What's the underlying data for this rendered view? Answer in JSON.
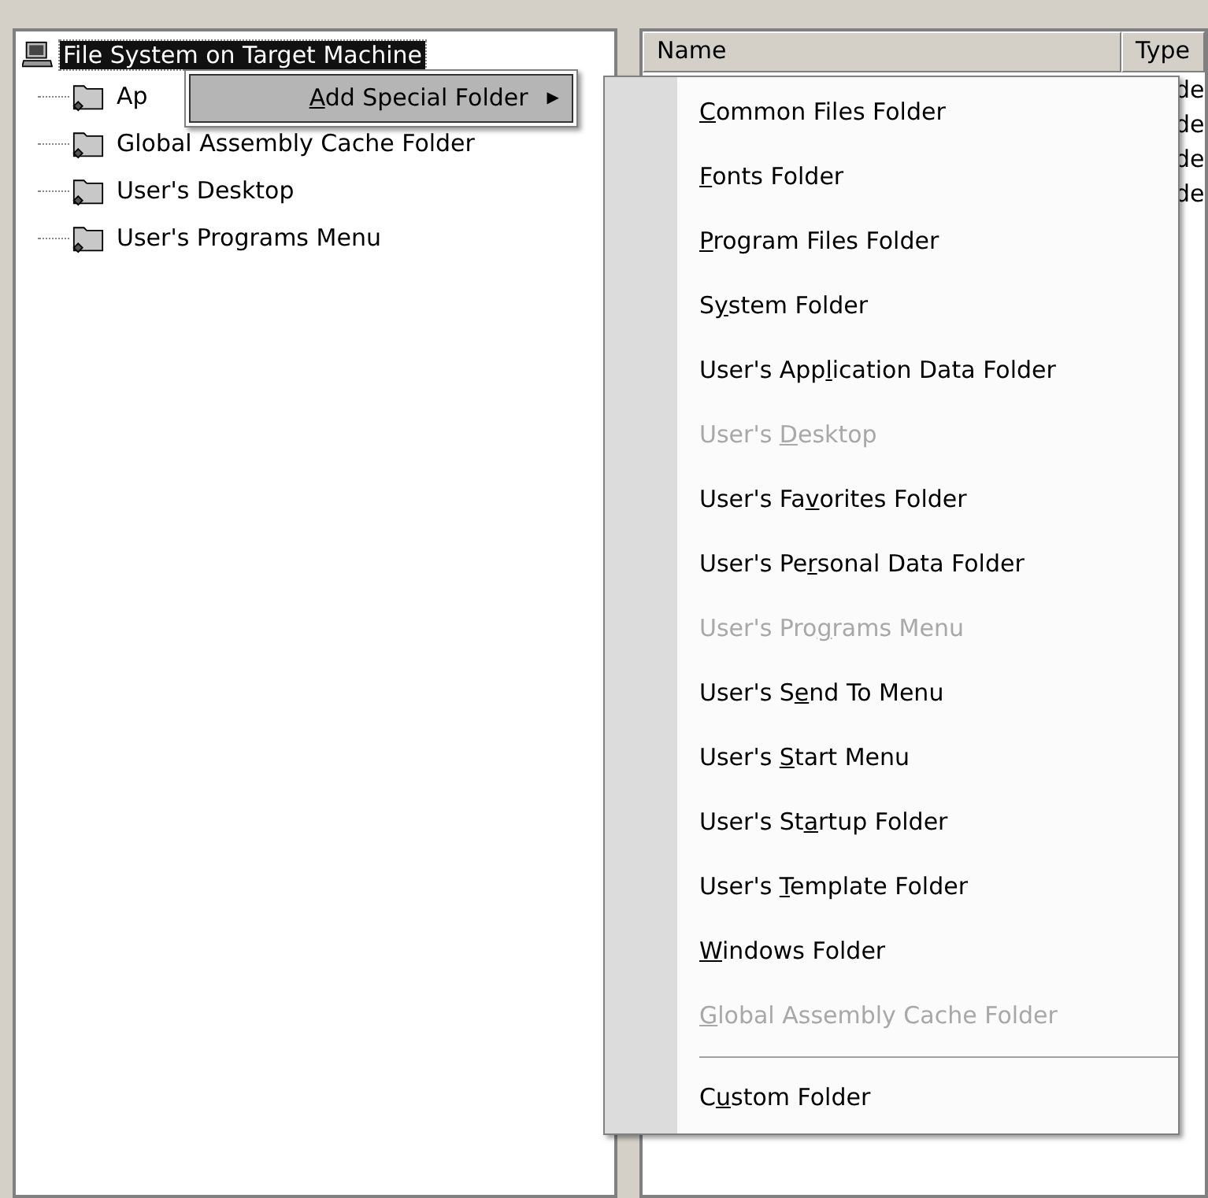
{
  "tree": {
    "label": "File System on Target Machine",
    "selected": true,
    "children": [
      {
        "label": "Ap"
      },
      {
        "label": "Global Assembly Cache Folder"
      },
      {
        "label": "User's Desktop"
      },
      {
        "label": "User's Programs Menu"
      }
    ]
  },
  "list": {
    "columns": [
      "Name",
      "Type"
    ],
    "rows": [
      {
        "column_2": "de"
      },
      {
        "column_2": "de"
      },
      {
        "column_2": "de"
      },
      {
        "column_2": "de"
      }
    ]
  },
  "context_menu": {
    "items": [
      {
        "label": {
          "key": "A",
          "after": "dd Special Folder"
        },
        "submenu_arrow": "▶",
        "selected": true
      }
    ]
  },
  "submenu": {
    "items": [
      {
        "kind": "item",
        "label": {
          "key": "C",
          "after": "ommon Files Folder"
        },
        "disabled": false
      },
      {
        "kind": "item",
        "label": {
          "key": "F",
          "after": "onts Folder"
        },
        "disabled": false
      },
      {
        "kind": "item",
        "label": {
          "key": "P",
          "after": "rogram Files Folder"
        },
        "disabled": false
      },
      {
        "kind": "item",
        "label": {
          "before": "S",
          "key": "y",
          "after": "stem Folder"
        },
        "disabled": false
      },
      {
        "kind": "item",
        "label": {
          "before": "User's App",
          "key": "l",
          "after": "ication Data Folder"
        },
        "disabled": false
      },
      {
        "kind": "item",
        "label": {
          "before": "User's ",
          "key": "D",
          "after": "esktop"
        },
        "disabled": true
      },
      {
        "kind": "item",
        "label": {
          "before": "User's Fa",
          "key": "v",
          "after": "orites Folder"
        },
        "disabled": false
      },
      {
        "kind": "item",
        "label": {
          "before": "User's Pe",
          "key": "r",
          "after": "sonal Data Folder"
        },
        "disabled": false
      },
      {
        "kind": "item",
        "label": {
          "before": "User's Pro",
          "key": "g",
          "after": "rams Menu"
        },
        "disabled": true
      },
      {
        "kind": "item",
        "label": {
          "before": "User's S",
          "key": "e",
          "after": "nd To Menu"
        },
        "disabled": false
      },
      {
        "kind": "item",
        "label": {
          "before": "User's ",
          "key": "S",
          "after": "tart Menu"
        },
        "disabled": false
      },
      {
        "kind": "item",
        "label": {
          "before": "User's St",
          "key": "a",
          "after": "rtup Folder"
        },
        "disabled": false
      },
      {
        "kind": "item",
        "label": {
          "before": "User's ",
          "key": "T",
          "after": "emplate Folder"
        },
        "disabled": false
      },
      {
        "kind": "item",
        "label": {
          "key": "W",
          "after": "indows Folder"
        },
        "disabled": false
      },
      {
        "kind": "item",
        "label": {
          "key": "G",
          "after": "lobal Assembly Cache Folder"
        },
        "disabled": true
      },
      {
        "kind": "separator"
      },
      {
        "kind": "item",
        "label": {
          "before": "C",
          "key": "u",
          "after": "stom Folder"
        },
        "disabled": false
      }
    ]
  }
}
